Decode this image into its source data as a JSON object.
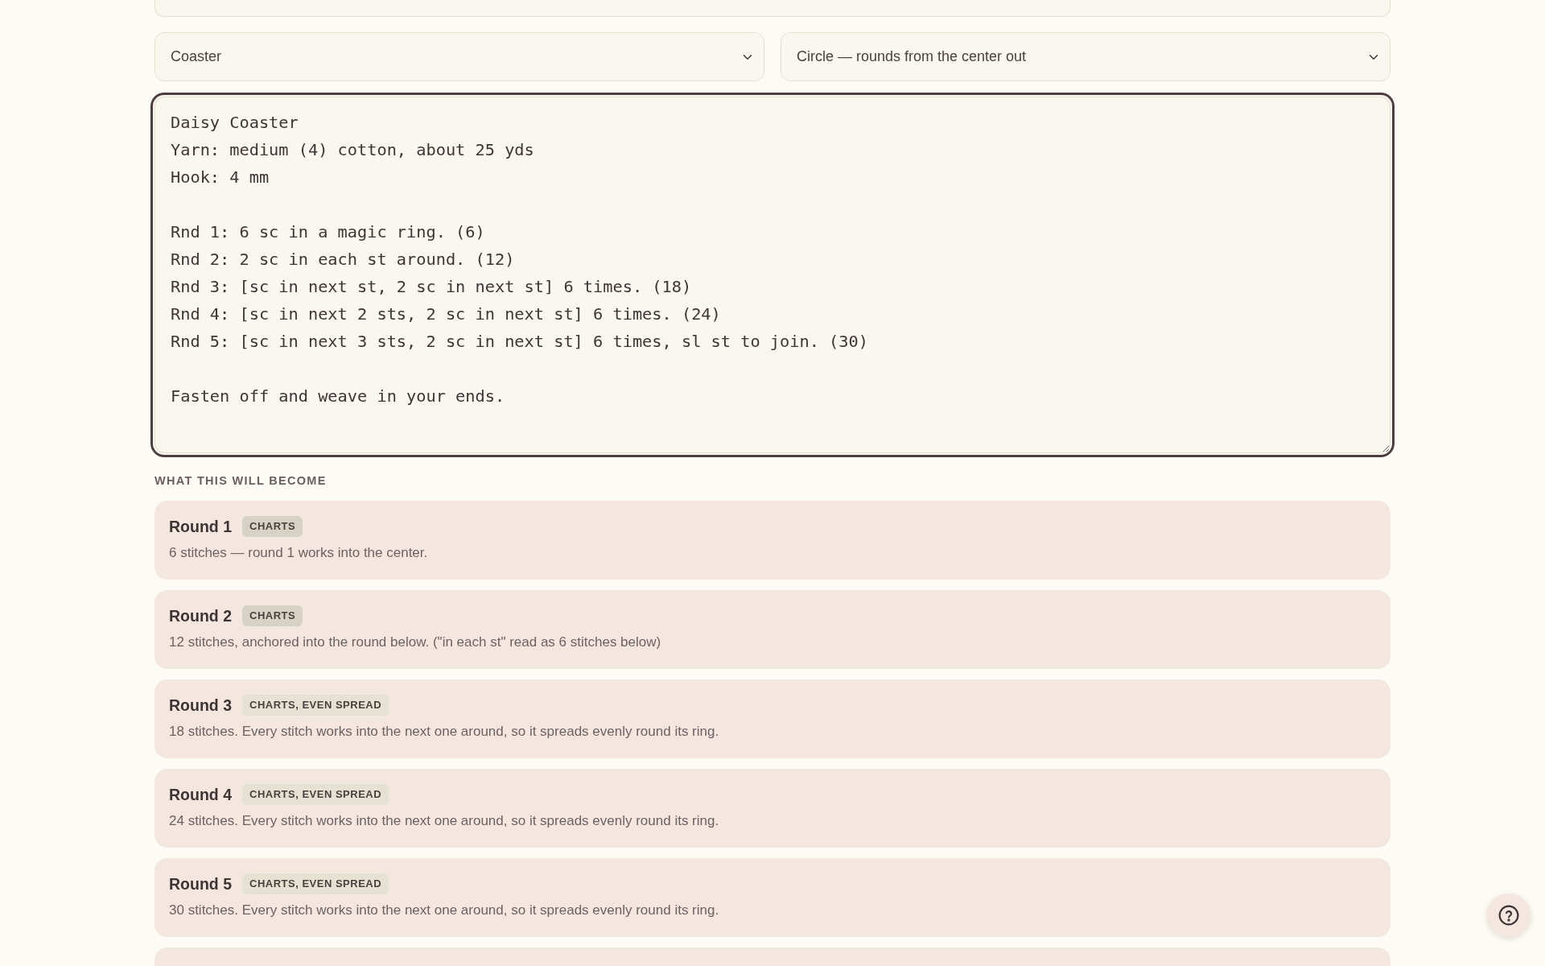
{
  "selects": [
    {
      "value": "Coaster"
    },
    {
      "value": "Circle — rounds from the center out"
    }
  ],
  "pattern_text": {
    "value": "Daisy Coaster\nYarn: medium (4) cotton, about 25 yds\nHook: 4 mm\n\nRnd 1: 6 sc in a magic ring. (6)\nRnd 2: 2 sc in each st around. (12)\nRnd 3: [sc in next st, 2 sc in next st] 6 times. (18)\nRnd 4: [sc in next 2 sts, 2 sc in next st] 6 times. (24)\nRnd 5: [sc in next 3 sts, 2 sc in next st] 6 times, sl st to join. (30)\n\nFasten off and weave in your ends.",
    "focused": true
  },
  "preview": {
    "heading": "WHAT THIS WILL BECOME",
    "rounds": [
      {
        "title": "Round 1",
        "tag": {
          "text": "CHARTS",
          "color": "#d6d2c5"
        },
        "description": "6 stitches — round 1 works into the center."
      },
      {
        "title": "Round 2",
        "tag": {
          "text": "CHARTS",
          "color": "#d6d2c5"
        },
        "description": "12 stitches, anchored into the round below. (\"in each st\" read as 6 stitches below)"
      },
      {
        "title": "Round 3",
        "tag": {
          "text": "CHARTS, EVEN SPREAD",
          "color": "#e6e2d3"
        },
        "description": "18 stitches. Every stitch works into the next one around, so it spreads evenly round its ring."
      },
      {
        "title": "Round 4",
        "tag": {
          "text": "CHARTS, EVEN SPREAD",
          "color": "#e6e2d3"
        },
        "description": "24 stitches. Every stitch works into the next one around, so it spreads evenly round its ring."
      },
      {
        "title": "Round 5",
        "tag": {
          "text": "CHARTS, EVEN SPREAD",
          "color": "#e6e2d3"
        },
        "description": "30 stitches. Every stitch works into the next one around, so it spreads evenly round its ring."
      }
    ]
  }
}
